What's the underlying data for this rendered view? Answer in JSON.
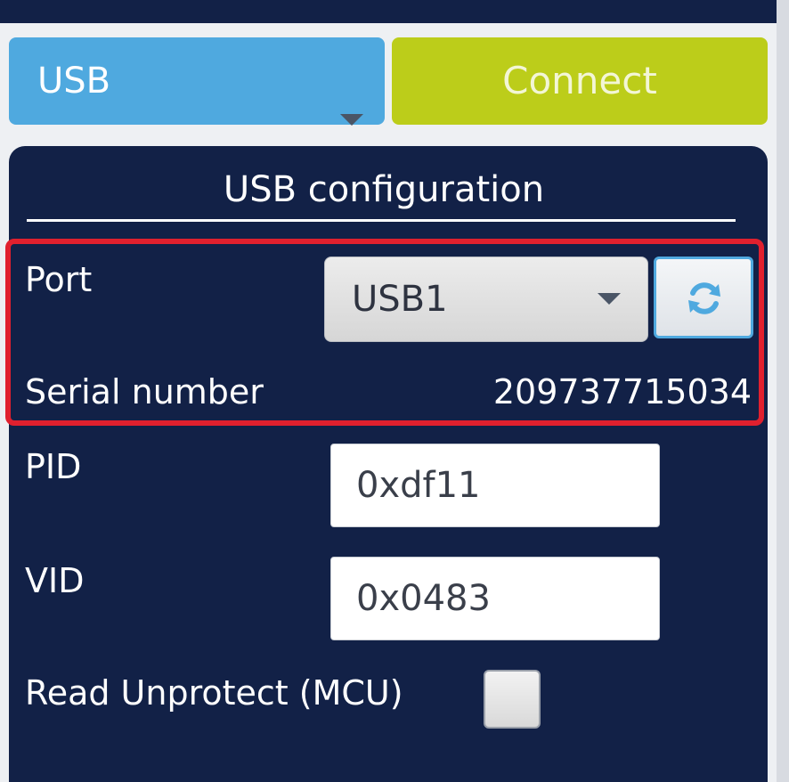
{
  "interface_select": {
    "value": "USB"
  },
  "connect_button": {
    "label": "Connect"
  },
  "usb_config": {
    "title": "USB configuration",
    "port": {
      "label": "Port",
      "value": "USB1"
    },
    "serial_number": {
      "label": "Serial number",
      "value": "209737715034"
    },
    "pid": {
      "label": "PID",
      "value": "0xdf11"
    },
    "vid": {
      "label": "VID",
      "value": "0x0483"
    },
    "read_unprotect": {
      "label": "Read Unprotect (MCU)",
      "checked": false
    }
  },
  "colors": {
    "panel_bg": "#122147",
    "interface_select_bg": "#4fa9df",
    "connect_bg": "#bccd1a",
    "highlight_border": "#e0202e"
  },
  "icons": {
    "dropdown": "chevron-down-icon",
    "refresh": "refresh-icon"
  }
}
